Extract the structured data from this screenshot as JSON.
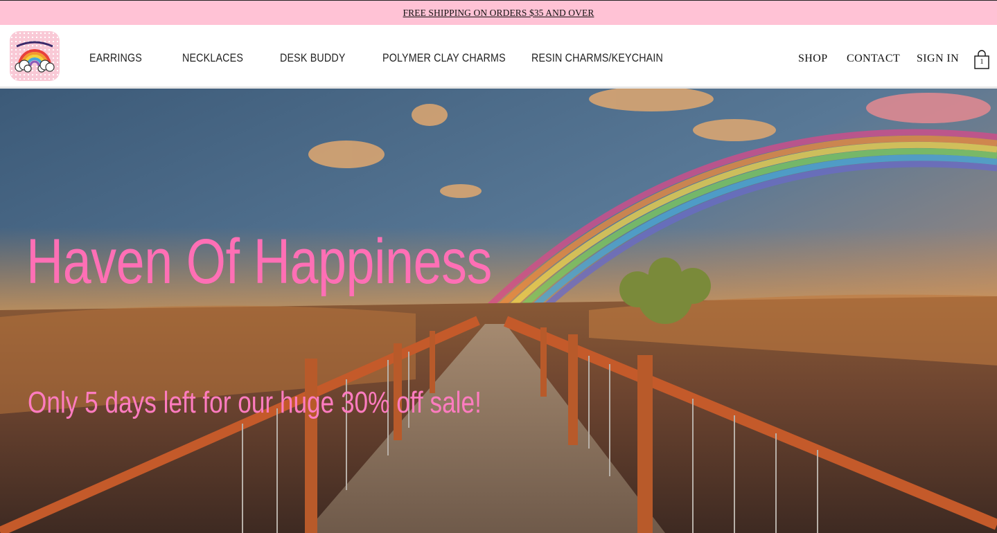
{
  "announcement": {
    "text": "FREE SHIPPING ON ORDERS $35 AND OVER"
  },
  "nav": {
    "items": [
      {
        "label": "EARRINGS"
      },
      {
        "label": "NECKLACES"
      },
      {
        "label": "DESK BUDDY"
      },
      {
        "label": "POLYMER CLAY CHARMS"
      },
      {
        "label": "RESIN CHARMS/KEYCHAIN"
      }
    ]
  },
  "utility": {
    "shop": "SHOP",
    "contact": "CONTACT",
    "sign_in": "SIGN IN",
    "cart_count": "1"
  },
  "hero": {
    "title": "Haven Of Happiness",
    "subtitle": "Only 5 days left for our huge 30% off sale!"
  },
  "colors": {
    "announcement_bg": "#ffc2d5",
    "accent_pink": "#ff6fb5"
  },
  "icons": {
    "logo": "rainbow-cloud-logo",
    "cart": "shopping-bag-icon"
  }
}
